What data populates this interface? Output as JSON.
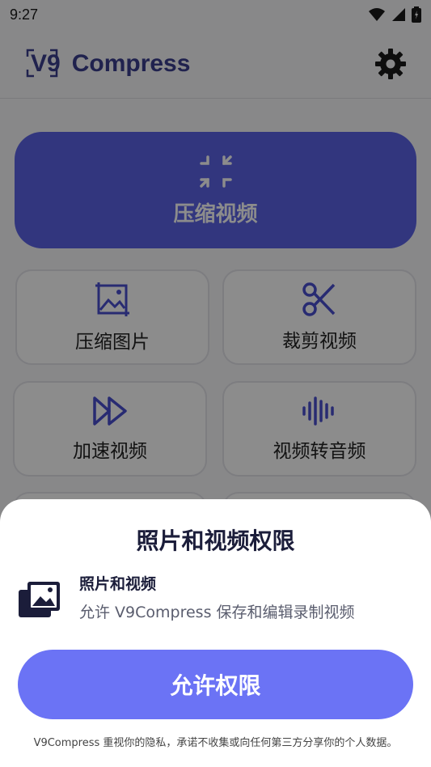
{
  "status_bar": {
    "time": "9:27",
    "icons": [
      "wifi-icon",
      "signal-icon",
      "battery-icon"
    ]
  },
  "app_bar": {
    "logo_mark": "V9",
    "logo_text": "Compress",
    "settings_icon": "gear-icon"
  },
  "hero": {
    "icon": "compress-arrows-icon",
    "label": "压缩视频"
  },
  "tiles": [
    {
      "label": "压缩图片",
      "icon": "image-compress-icon"
    },
    {
      "label": "裁剪视频",
      "icon": "scissors-icon"
    },
    {
      "label": "加速视频",
      "icon": "fast-forward-icon"
    },
    {
      "label": "视频转音频",
      "icon": "audio-wave-icon"
    }
  ],
  "sheet": {
    "title": "照片和视频权限",
    "permission": {
      "icon": "photos-icon",
      "name": "照片和视频",
      "description": "允许 V9Compress 保存和编辑录制视频"
    },
    "allow_button": "允许权限",
    "privacy_note": "V9Compress 重视你的隐私，承诺不收集或向任何第三方分享你的个人数据。"
  },
  "colors": {
    "accent": "#5b63e6",
    "button": "#6b73f5",
    "brand_text": "#3b3f8f",
    "overlay": "rgba(0,0,0,0.45)"
  }
}
